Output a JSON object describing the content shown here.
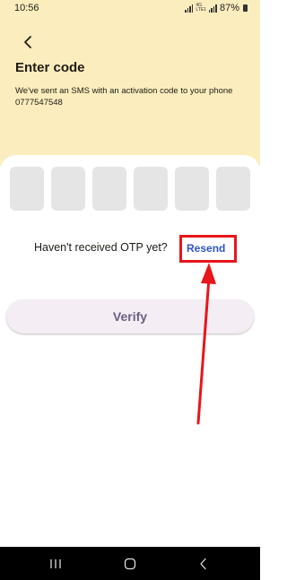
{
  "status_bar": {
    "time": "10:56",
    "network": "4G",
    "network_sub": "LTE1",
    "vo_label": "Vo)",
    "battery": "87%"
  },
  "header": {
    "title": "Enter code",
    "subtitle": "We've sent an SMS with an activation code to your phone 0777547548"
  },
  "otp": {
    "digit_count": 6
  },
  "resend": {
    "prompt": "Haven't received OTP yet?",
    "link": "Resend"
  },
  "verify": {
    "label": "Verify"
  },
  "colors": {
    "header_bg": "#fbedbd",
    "otp_box": "#e5e5e5",
    "resend_link": "#2f56c6",
    "annotation": "#e8151b",
    "verify_bg": "#f4edf4",
    "verify_text": "#6d5e83",
    "nav_bar": "#000000"
  },
  "icons": {
    "back": "chevron-left-icon",
    "nav_recents": "recents-icon",
    "nav_home": "home-icon",
    "nav_back": "nav-back-icon"
  }
}
